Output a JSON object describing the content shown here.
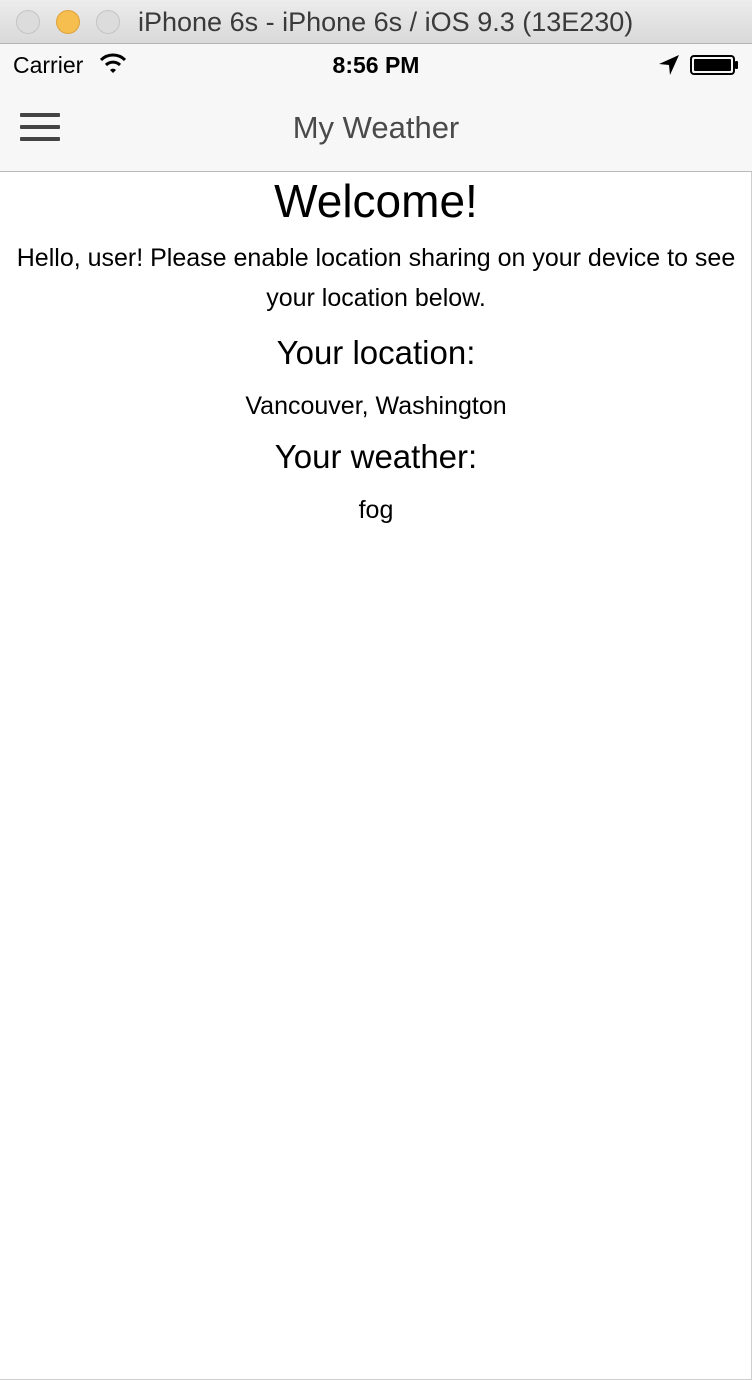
{
  "window": {
    "title": "iPhone 6s - iPhone 6s / iOS 9.3 (13E230)"
  },
  "status_bar": {
    "carrier": "Carrier",
    "time": "8:56 PM",
    "icons": [
      "wifi-icon",
      "location-arrow-icon",
      "battery-icon"
    ]
  },
  "nav": {
    "title": "My Weather",
    "menu_icon": "hamburger-menu-icon"
  },
  "main": {
    "welcome": "Welcome!",
    "intro": "Hello, user! Please enable location sharing on your device to see your location below.",
    "location_heading": "Your location:",
    "location_value": "Vancouver, Washington",
    "weather_heading": "Your weather:",
    "weather_value": "fog"
  },
  "colors": {
    "traffic_minimize": "#f6be4f",
    "bar_background": "#f7f7f7",
    "nav_title": "#4a4a4a"
  }
}
